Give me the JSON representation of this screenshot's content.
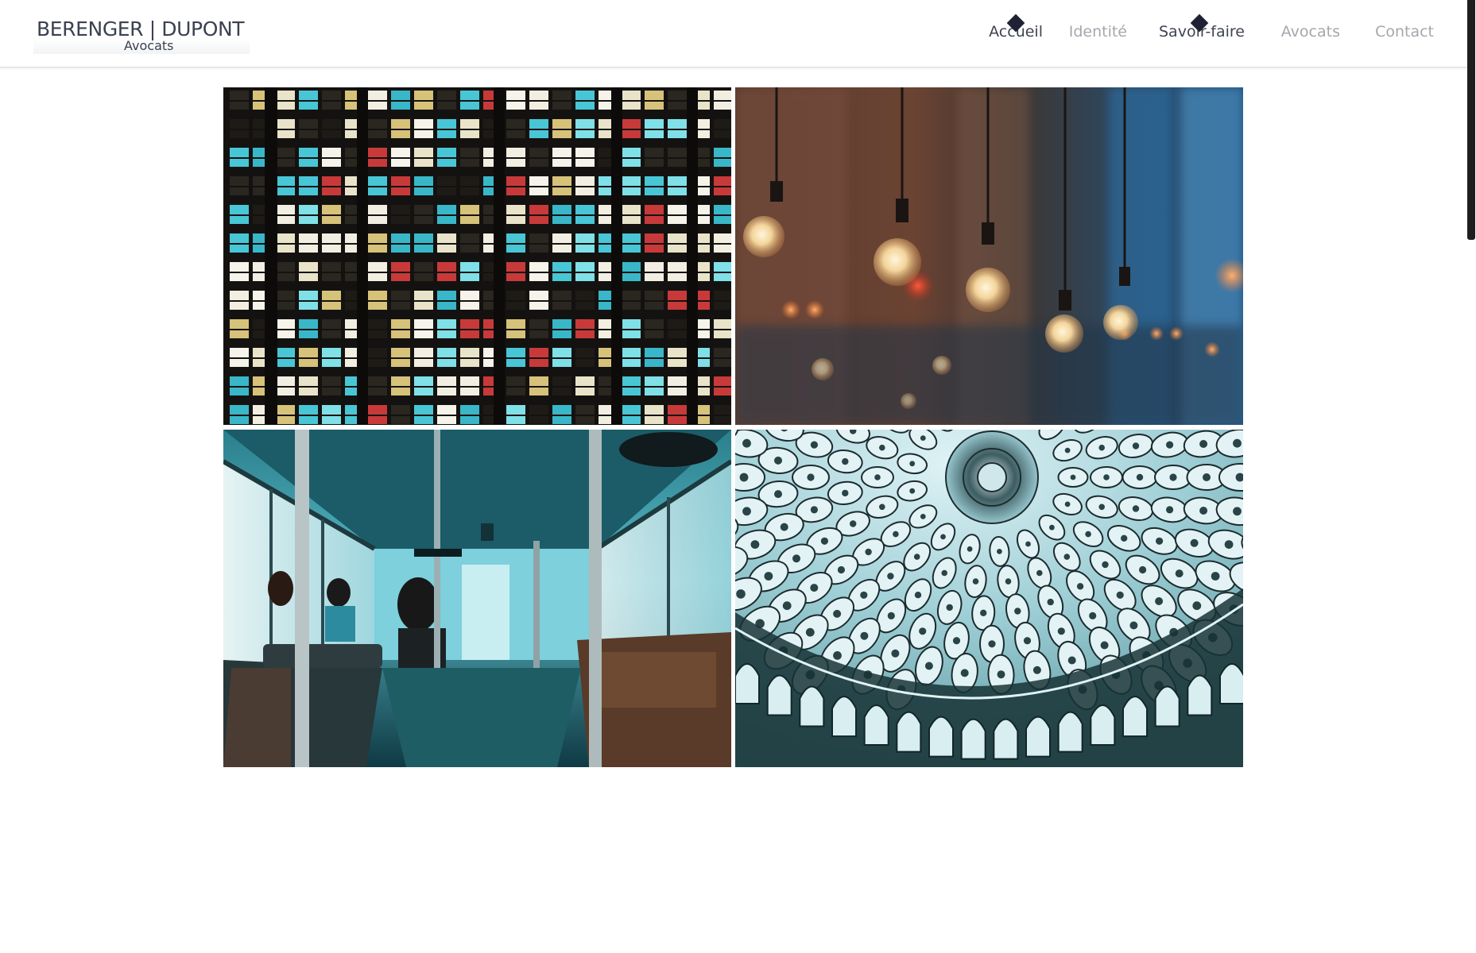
{
  "header": {
    "logo_name": "BERENGER | DUPONT",
    "logo_sub": "Avocats"
  },
  "nav": {
    "items": [
      {
        "label": "Accueil",
        "active": true
      },
      {
        "label": "Identité",
        "active": false
      },
      {
        "label": "Savoir-faire",
        "active": true
      },
      {
        "label": "Avocats",
        "active": false
      },
      {
        "label": "Contact",
        "active": false
      }
    ]
  },
  "gallery": {
    "tiles": [
      {
        "subject": "building-windows-night"
      },
      {
        "subject": "hanging-light-bulbs"
      },
      {
        "subject": "bus-interior"
      },
      {
        "subject": "ornate-dome-ceiling"
      }
    ]
  },
  "colors": {
    "text_dark": "#3e4451",
    "text_muted": "#a3a8ad",
    "marker": "#1f2233",
    "scroll_thumb": "#1e1e1e"
  }
}
